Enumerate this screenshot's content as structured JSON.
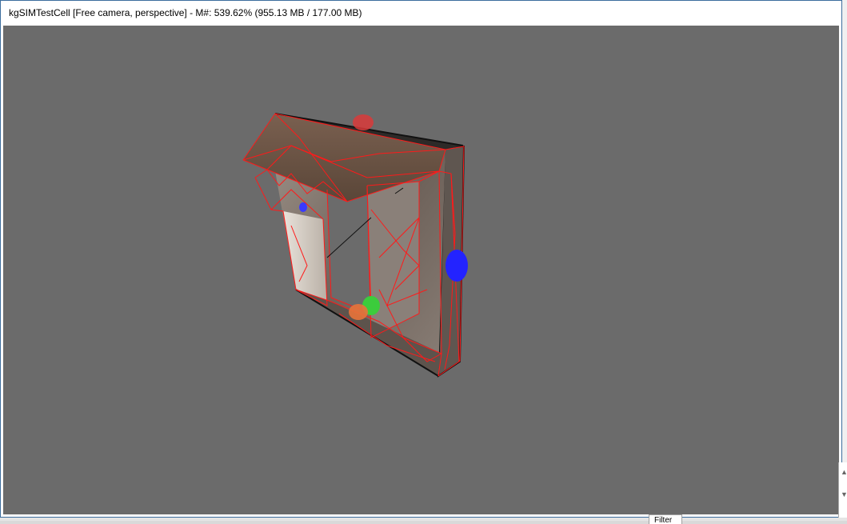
{
  "window": {
    "title": "kgSIMTestCell [Free camera, perspective] - M#: 539.62% (955.13 MB / 177.00 MB)"
  },
  "viewport": {
    "background_color": "#6b6b6b",
    "wireframe_color": "#ff1a1a",
    "object": "window-frame-model",
    "gizmos": {
      "red": "#d93a3a",
      "blue": "#2323ff",
      "green": "#3ccc3c",
      "orange": "#e8733a"
    }
  },
  "bottom_panel": {
    "filter_tab_label": "Filter"
  },
  "side_panel": {
    "arrow_up_icon": "chevron-up-icon",
    "arrow_down_icon": "chevron-down-icon"
  }
}
